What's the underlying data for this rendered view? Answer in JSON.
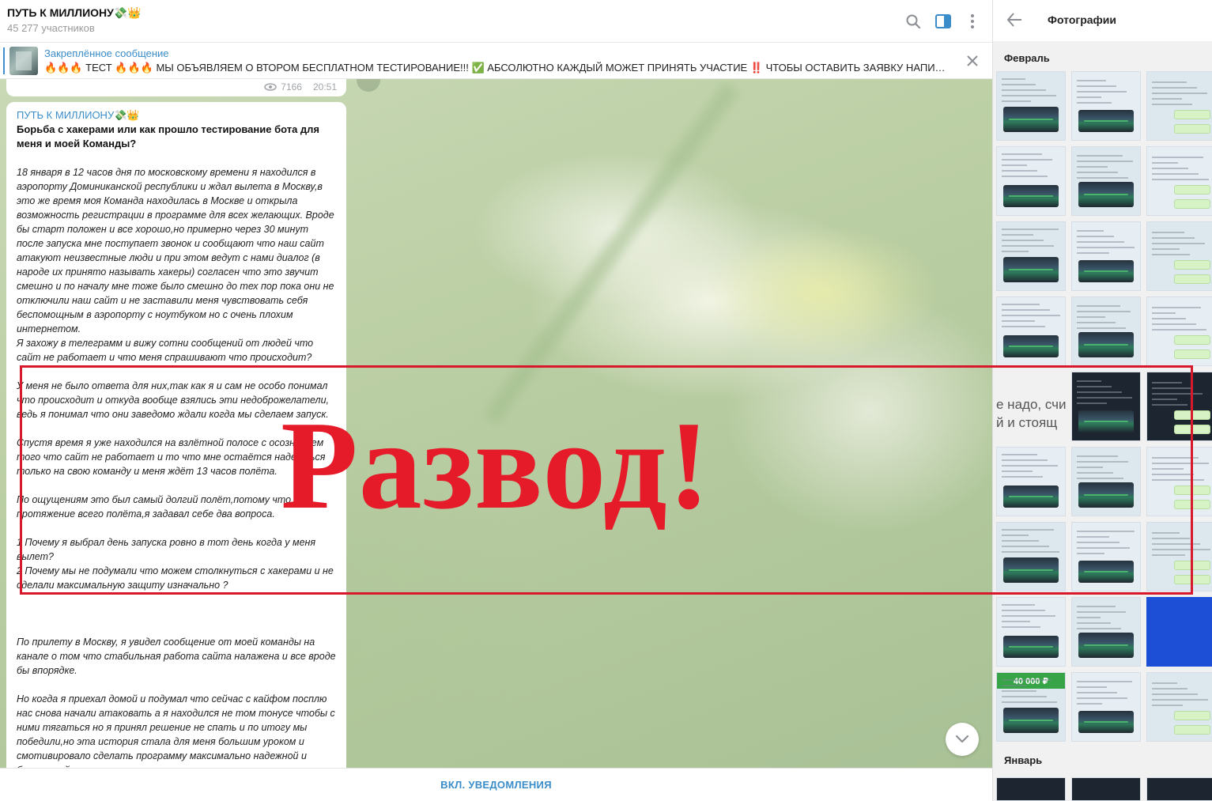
{
  "header": {
    "title": "ПУТЬ К МИЛЛИОНУ💸👑",
    "subscribers": "45 277 участников",
    "icons": [
      "search-icon",
      "sidebar-toggle-icon",
      "more-vertical-icon"
    ]
  },
  "pinned": {
    "label": "Закреплённое сообщение",
    "text": "🔥🔥🔥 ТЕСТ 🔥🔥🔥  МЫ ОБЪЯВЛЯЕМ О ВТОРОМ БЕСПЛАТНОМ ТЕСТИРОВАНИЕ!!! ✅ АБСОЛЮТНО КАЖДЫЙ МОЖЕТ ПРИНЯТЬ УЧАСТИЕ ‼️  ЧТОБЫ ОСТАВИТЬ ЗАЯВКУ НАПИ…",
    "icons": [
      "close-icon"
    ]
  },
  "prev_message": {
    "views": "7166",
    "time": "20:51"
  },
  "message": {
    "author": "ПУТЬ К МИЛЛИОНУ💸👑",
    "title": "Борьба с хакерами или как прошло тестирование бота для меня и моей Команды?",
    "paragraphs": [
      "18 января в 12 часов дня по московскому времени я находился в аэропорту Доминиканской республики и ждал вылета в Москву,в это же время моя Команда находилась в Москве и открыла возможность регистрации  в программе для всех желающих. Вроде бы старт положен и все хорошо,но примерно через 30 минут после запуска мне поступает звонок и сообщают что наш сайт атакуют неизвестные люди и при этом ведут с нами диалог (в народе их принято называть хакеры) согласен что это звучит смешно и по началу мне тоже было смешно до тех пор пока они не отключили наш сайт и не заставили меня чувствовать себя беспомощным в аэропорту с ноутбуком но с очень плохим интернетом.\nЯ захожу в телеграмм и вижу сотни сообщений от людей что сайт не работает и что меня спрашивают что происходит?",
      "У меня не было ответа для них,так как я и сам не особо понимал что происходит и откуда вообще взялись эти недоброжелатели, ведь я понимал что они заведомо ждали когда мы сделаем запуск.",
      "Спустя время я уже находился на взлётной полосе с осознанием того что сайт не работает и то что мне остаётся надеяться только на свою команду и меня ждёт 13 часов полёта.",
      "По ощущениям это был самый долгий полёт,потому что на протяжение всего полёта,я задавал себе два вопроса.",
      "1 Почему я выбрал день запуска ровно в тот день когда у меня вылет?\n2 Почему мы не подумали что можем столкнуться с хакерами и не сделали максимальную защиту изначально ?",
      "",
      "По прилету в Москву, я увидел сообщение от моей команды на канале о том что стабильная работа сайта налажена и все вроде бы впорядке.",
      "Но когда я приехал домой и подумал что сейчас с кайфом посплю нас снова начали атаковать а я находился не том тонусе чтобы с ними тягаться но я принял решение не спать и по итогу мы победили,но эта история стала для меня большим уроком и смотивировало сделать программу максимально надежной и безопасной."
    ]
  },
  "footer": {
    "notify_label": "ВКЛ. УВЕДОМЛЕНИЯ"
  },
  "media_panel": {
    "title": "Фотографии",
    "month_1": "Февраль",
    "month_2": "Январь",
    "fragment_line1": "е надо, счи",
    "fragment_line2": "й и стоящ",
    "price_thumb": "40 000 ₽"
  },
  "stamp": {
    "text": "Развод!"
  },
  "colors": {
    "accent": "#3a8dc9",
    "stamp": "#e51b2a",
    "price_green": "#37a447"
  }
}
